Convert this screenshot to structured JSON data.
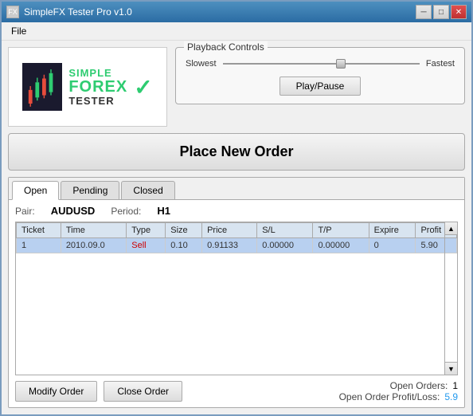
{
  "window": {
    "title": "SimpleFX Tester Pro v1.0",
    "min_btn": "─",
    "max_btn": "□",
    "close_btn": "✕"
  },
  "menu": {
    "items": [
      "File"
    ]
  },
  "logo": {
    "simple": "SIMPLE",
    "forex": "FOREX",
    "tester": "TESTER",
    "checkmark": "✓"
  },
  "playback": {
    "group_label": "Playback Controls",
    "slowest_label": "Slowest",
    "fastest_label": "Fastest",
    "play_pause_label": "Play/Pause"
  },
  "place_order": {
    "label": "Place New Order"
  },
  "tabs": {
    "items": [
      {
        "id": "open",
        "label": "Open",
        "active": true
      },
      {
        "id": "pending",
        "label": "Pending",
        "active": false
      },
      {
        "id": "closed",
        "label": "Closed",
        "active": false
      }
    ]
  },
  "orders_panel": {
    "pair_label": "Pair:",
    "pair_value": "AUDUSD",
    "period_label": "Period:",
    "period_value": "H1",
    "columns": [
      "Ticket",
      "Time",
      "Type",
      "Size",
      "Price",
      "S/L",
      "T/P",
      "Expire",
      "Profit"
    ],
    "rows": [
      {
        "ticket": "1",
        "time": "2010.09.0",
        "type": "Sell",
        "size": "0.10",
        "price": "0.91133",
        "sl": "0.00000",
        "tp": "0.00000",
        "expire": "0",
        "profit": "5.90",
        "selected": true
      }
    ]
  },
  "actions": {
    "modify_order": "Modify Order",
    "close_order": "Close Order"
  },
  "stats": {
    "open_orders_label": "Open Orders:",
    "open_orders_value": "1",
    "profit_loss_label": "Open Order Profit/Loss:",
    "profit_loss_value": "5.9"
  }
}
